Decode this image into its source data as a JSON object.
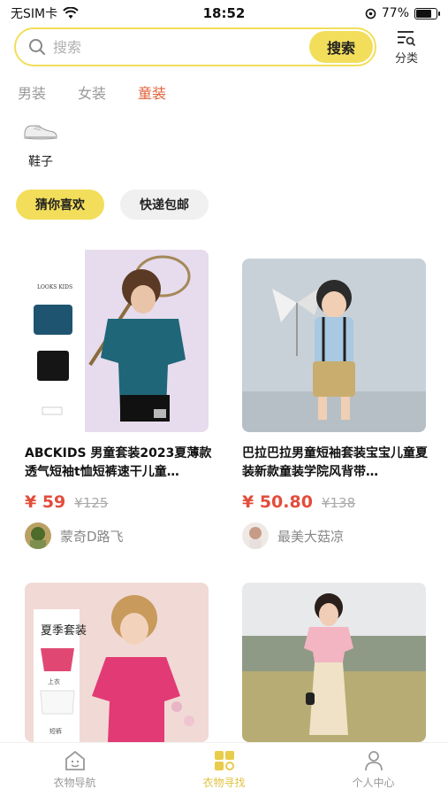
{
  "status_bar": {
    "carrier": "无SIM卡",
    "time": "18:52",
    "battery": "77%",
    "battery_level": 0.77
  },
  "search": {
    "placeholder": "搜索",
    "button_label": "搜索",
    "category_label": "分类"
  },
  "tabs": [
    {
      "label": "男装",
      "active": false
    },
    {
      "label": "女装",
      "active": false
    },
    {
      "label": "童装",
      "active": true
    }
  ],
  "sub_categories": [
    {
      "label": "鞋子"
    }
  ],
  "filter_chips": [
    {
      "label": "猜你喜欢",
      "active": true
    },
    {
      "label": "快递包邮",
      "active": false
    }
  ],
  "products": [
    {
      "title": "ABCKIDS 男童套装2023夏薄款透气短袖t恤短裤速干儿童…",
      "price": "¥ 59",
      "original_price": "¥125",
      "seller": "蒙奇D路飞",
      "image_text": "LOOKS KIDS"
    },
    {
      "title": "巴拉巴拉男童短袖套装宝宝儿童夏装新款童装学院风背带…",
      "price": "¥ 50.80",
      "original_price": "¥138",
      "seller": "最美大菇凉"
    },
    {
      "title": "",
      "image_text": "夏季套装",
      "image_tag_1": "上衣",
      "image_tag_2": "短裤"
    },
    {
      "title": ""
    }
  ],
  "bottom_nav": [
    {
      "label": "衣物导航",
      "icon": "house-icon",
      "active": false
    },
    {
      "label": "衣物寻找",
      "icon": "grid-search-icon",
      "active": true
    },
    {
      "label": "个人中心",
      "icon": "person-icon",
      "active": false
    }
  ],
  "colors": {
    "accent": "#f2de5a",
    "price": "#e24d3b",
    "active_tab": "#e0623a"
  }
}
